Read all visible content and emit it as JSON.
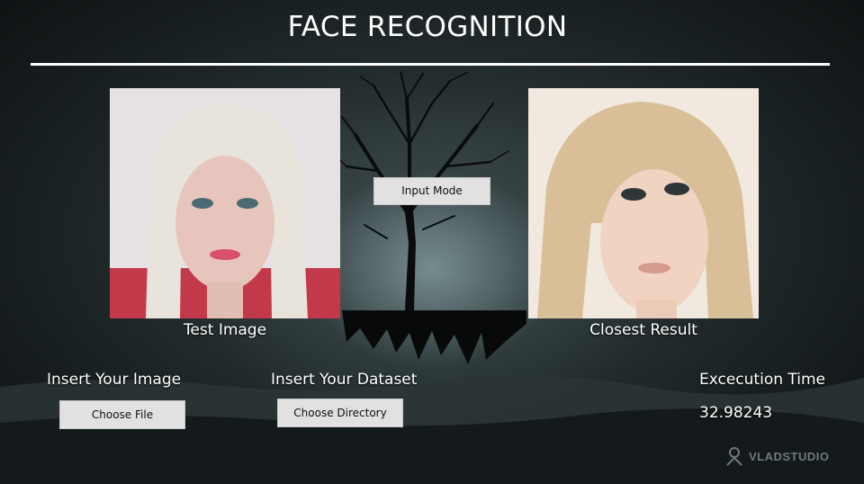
{
  "header": {
    "title": "FACE RECOGNITION"
  },
  "test_panel": {
    "caption": "Test Image",
    "photo_icon": "portrait-photo"
  },
  "result_panel": {
    "caption": "Closest Result",
    "photo_icon": "portrait-photo"
  },
  "controls": {
    "input_mode_label": "Input Mode",
    "insert_image_label": "Insert Your Image",
    "choose_file_label": "Choose File",
    "insert_dataset_label": "Insert Your Dataset",
    "choose_directory_label": "Choose Directory"
  },
  "execution": {
    "label": "Excecution Time",
    "value": "32.98243"
  },
  "watermark": {
    "text": "VLADSTUDIO",
    "icon": "vladstudio-logo-icon"
  },
  "colors": {
    "button_bg": "#e1e1e1",
    "text": "#ffffff",
    "rule": "#ffffff"
  }
}
